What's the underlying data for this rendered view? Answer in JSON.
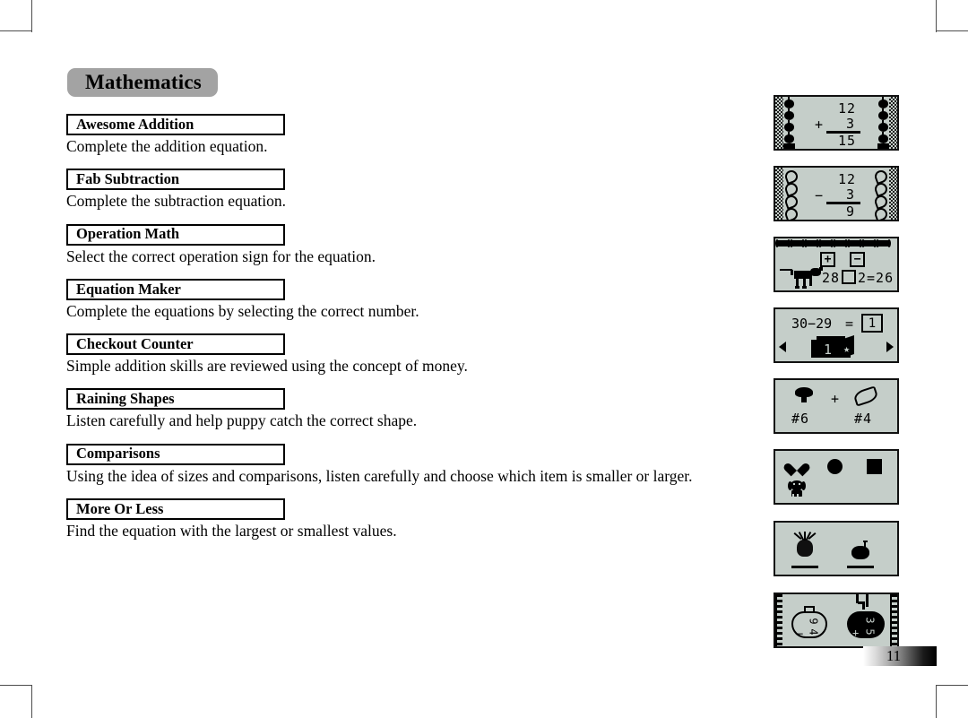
{
  "page": {
    "title": "Mathematics",
    "number": "11"
  },
  "entries": [
    {
      "name": "Awesome Addition",
      "desc": "Complete the addition equation.",
      "screen": {
        "kind": "addition",
        "operand_top": "12",
        "operand_bottom": "3",
        "operator": "+",
        "result": "15",
        "border_motif": "apple-border"
      }
    },
    {
      "name": "Fab Subtraction",
      "desc": "Complete the subtraction equation.",
      "screen": {
        "kind": "subtraction",
        "operand_top": "12",
        "operand_bottom": "3",
        "operator": "−",
        "result": "9",
        "border_motif": "swirl-border"
      }
    },
    {
      "name": "Operation Math",
      "desc": "Select the correct operation sign for the equation.",
      "screen": {
        "kind": "operation-choice",
        "choice_plus": "+",
        "choice_minus": "−",
        "equation_left": "28",
        "equation_right": "2=26",
        "border_motif": "bone-border",
        "character": "cow"
      }
    },
    {
      "name": "Equation Maker",
      "desc": "Complete the equations by selecting the correct number.",
      "screen": {
        "kind": "equation-maker",
        "equation": "30−29",
        "equals": "=",
        "answer": "1",
        "card_value": "1",
        "card_badge": "★",
        "arrow_left": "◀",
        "arrow_right": "▶"
      }
    },
    {
      "name": "Checkout Counter",
      "desc": "Simple addition skills are reviewed using the concept of money.",
      "screen": {
        "kind": "checkout",
        "item_left": "broccoli",
        "price_left": "#6",
        "operator": "+",
        "item_right": "pea-pod",
        "price_right": "#4"
      }
    },
    {
      "name": "Raining Shapes",
      "desc": "Listen carefully and help puppy catch the correct shape.",
      "screen": {
        "kind": "shapes",
        "shapes": [
          "heart",
          "circle",
          "square"
        ],
        "character": "puppy"
      }
    },
    {
      "name": "Comparisons",
      "desc": "Using the idea of sizes and comparisons, listen carefully and choose which item is smaller or larger.",
      "screen": {
        "kind": "comparisons",
        "item_left": "pineapple",
        "item_right": "strawberry"
      }
    },
    {
      "name": "More Or Less",
      "desc": "Find the equation with the largest or smallest values.",
      "screen": {
        "kind": "more-or-less",
        "bag_left_top": "9",
        "bag_left_op": "−",
        "bag_left_bottom": "4",
        "bag_right_top": "3",
        "bag_right_op": "+",
        "bag_right_bottom": "5",
        "border_motif": "film-strip"
      }
    }
  ],
  "colors": {
    "title_pill": "#a3a3a3",
    "lcd_background": "#c5cec9",
    "lcd_border": "#111111",
    "ink": "#000000"
  }
}
